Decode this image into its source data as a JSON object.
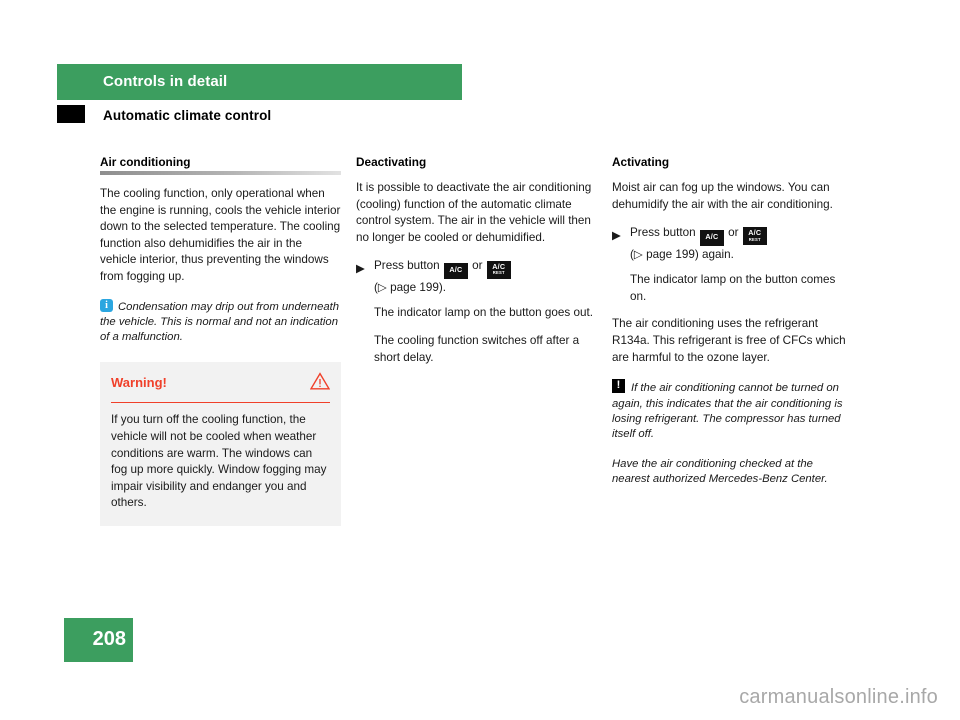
{
  "header": {
    "band_title": "Controls in detail",
    "subtitle": "Automatic climate control"
  },
  "colors": {
    "brand_green": "#3c9e5f",
    "warning_red": "#f0402a",
    "info_blue": "#2ba6e0",
    "warning_box_bg": "#f2f2f2"
  },
  "columns": {
    "left": {
      "heading": "Air conditioning",
      "paragraph_1": "The cooling function, only operational when the engine is running, cools the vehicle interior down to the selected temperature. The cooling function also dehumidifies the air in the vehicle interior, thus preventing the windows from fogging up.",
      "info_note": "Condensation may drip out from underneath the vehicle. This is normal and not an indication of a malfunction.",
      "info_icon": "info-icon",
      "warning": {
        "title": "Warning!",
        "icon": "warning-triangle-icon",
        "body": "If you turn off the cooling function, the vehicle will not be cooled when weather conditions are warm. The windows can fog up more quickly. Window fogging may impair visibility and endanger you and others."
      }
    },
    "middle": {
      "heading": "Deactivating",
      "paragraph_1": "It is possible to deactivate the air conditioning (cooling) function of the automatic climate control system. The air in the vehicle will then no longer be cooled or dehumidified.",
      "step": {
        "marker": "▶",
        "text_before": "Press button",
        "key_1": "A/C",
        "conjunction": "or",
        "key_2": "A/C",
        "key_2_sub": "REST",
        "reference": "(▷ page 199)."
      },
      "result_1": "The indicator lamp on the button goes out.",
      "result_2": "The cooling function switches off after a short delay."
    },
    "right": {
      "heading": "Activating",
      "paragraph_1": "Moist air can fog up the windows. You can dehumidify the air with the air conditioning.",
      "step": {
        "marker": "▶",
        "text_before": "Press button",
        "key_1": "A/C",
        "conjunction": "or",
        "key_2": "A/C",
        "key_2_sub": "REST",
        "reference": "(▷ page 199) again."
      },
      "result_1": "The indicator lamp on the button comes on.",
      "paragraph_2": "The air conditioning uses the refrigerant R134a. This refrigerant is free of CFCs which are harmful to the ozone layer.",
      "caution_note": "If the air conditioning cannot be turned on again, this indicates that the air conditioning is losing refrigerant. The compressor has turned itself off.",
      "caution_icon": "exclamation-box-icon",
      "caution_note_2": "Have the air conditioning checked at the nearest authorized Mercedes-Benz Center."
    }
  },
  "footer": {
    "page_number": "208",
    "watermark": "carmanualsonline.info"
  }
}
